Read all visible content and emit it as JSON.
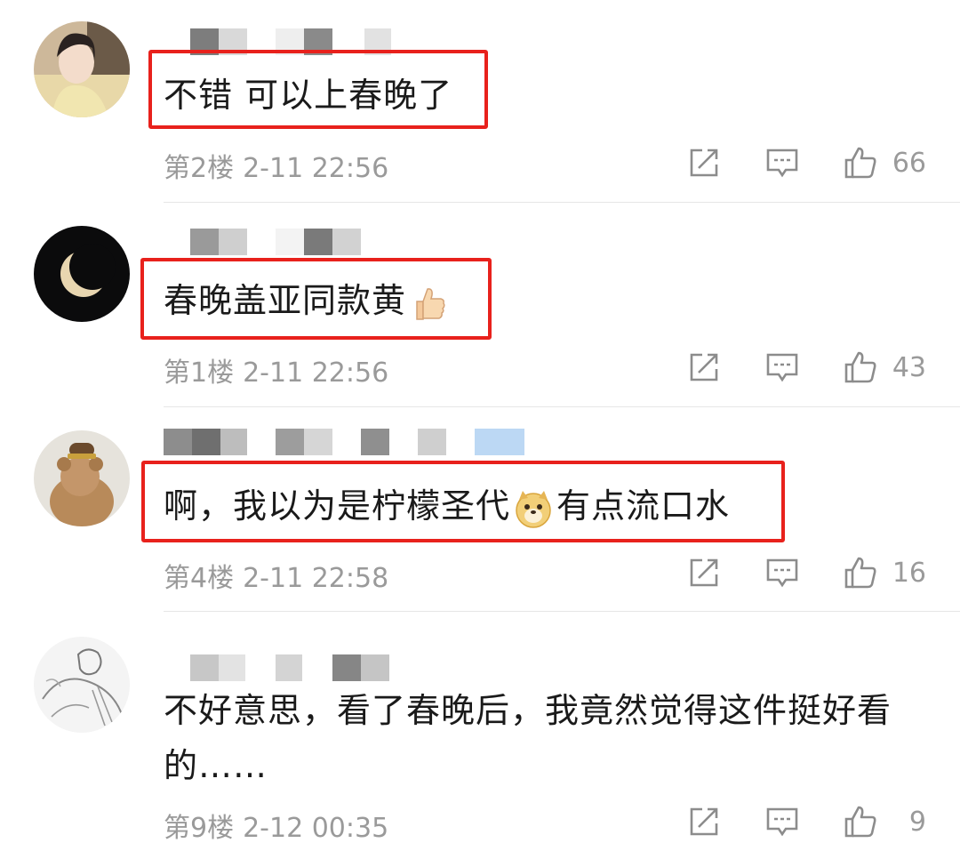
{
  "comments": [
    {
      "text": "不错 可以上春晚了",
      "floor": "第2楼",
      "time": "2-11 22:56",
      "likes": "66",
      "highlighted": true,
      "avatar_icon": "woman-portrait-avatar"
    },
    {
      "text": "春晚盖亚同款黄",
      "emoji_icon": "thumbs-up-emoji",
      "floor": "第1楼",
      "time": "2-11 22:56",
      "likes": "43",
      "highlighted": true,
      "avatar_icon": "crescent-moon-avatar"
    },
    {
      "text_before": "啊，我以为是柠檬圣代",
      "emoji_icon": "doge-emoji",
      "text_after": "有点流口水",
      "floor": "第4楼",
      "time": "2-11 22:58",
      "likes": "16",
      "highlighted": true,
      "avatar_icon": "teddy-bear-avatar"
    },
    {
      "text": "不好意思，看了春晚后，我竟然觉得这件挺好看的……",
      "floor": "第9楼",
      "time": "2-12 00:35",
      "likes": "9",
      "highlighted": false,
      "avatar_icon": "sketch-drawing-avatar"
    }
  ],
  "colors": {
    "highlight_border": "#e8211c",
    "meta_text": "#9a9a9a",
    "icon_stroke": "#8c8c8c"
  }
}
